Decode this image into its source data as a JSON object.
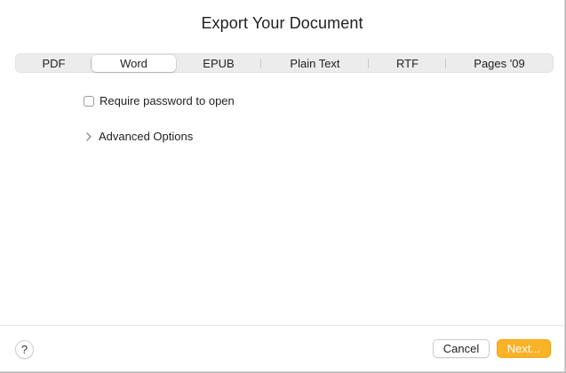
{
  "dialog": {
    "title": "Export Your Document"
  },
  "formats": {
    "tabs": [
      {
        "label": "PDF",
        "selected": false
      },
      {
        "label": "Word",
        "selected": true
      },
      {
        "label": "EPUB",
        "selected": false
      },
      {
        "label": "Plain Text",
        "selected": false
      },
      {
        "label": "RTF",
        "selected": false
      },
      {
        "label": "Pages '09",
        "selected": false
      }
    ]
  },
  "options": {
    "require_password_label": "Require password to open",
    "require_password_checked": false,
    "advanced_label": "Advanced Options",
    "advanced_expanded": false
  },
  "footer": {
    "help_label": "?",
    "cancel_label": "Cancel",
    "next_label": "Next..."
  },
  "colors": {
    "accent": "#fbb227",
    "background": "#ffffff",
    "segmented_background": "#ececec"
  },
  "icons": {
    "disclosure": "chevron-right-icon",
    "help": "question-mark-icon"
  }
}
